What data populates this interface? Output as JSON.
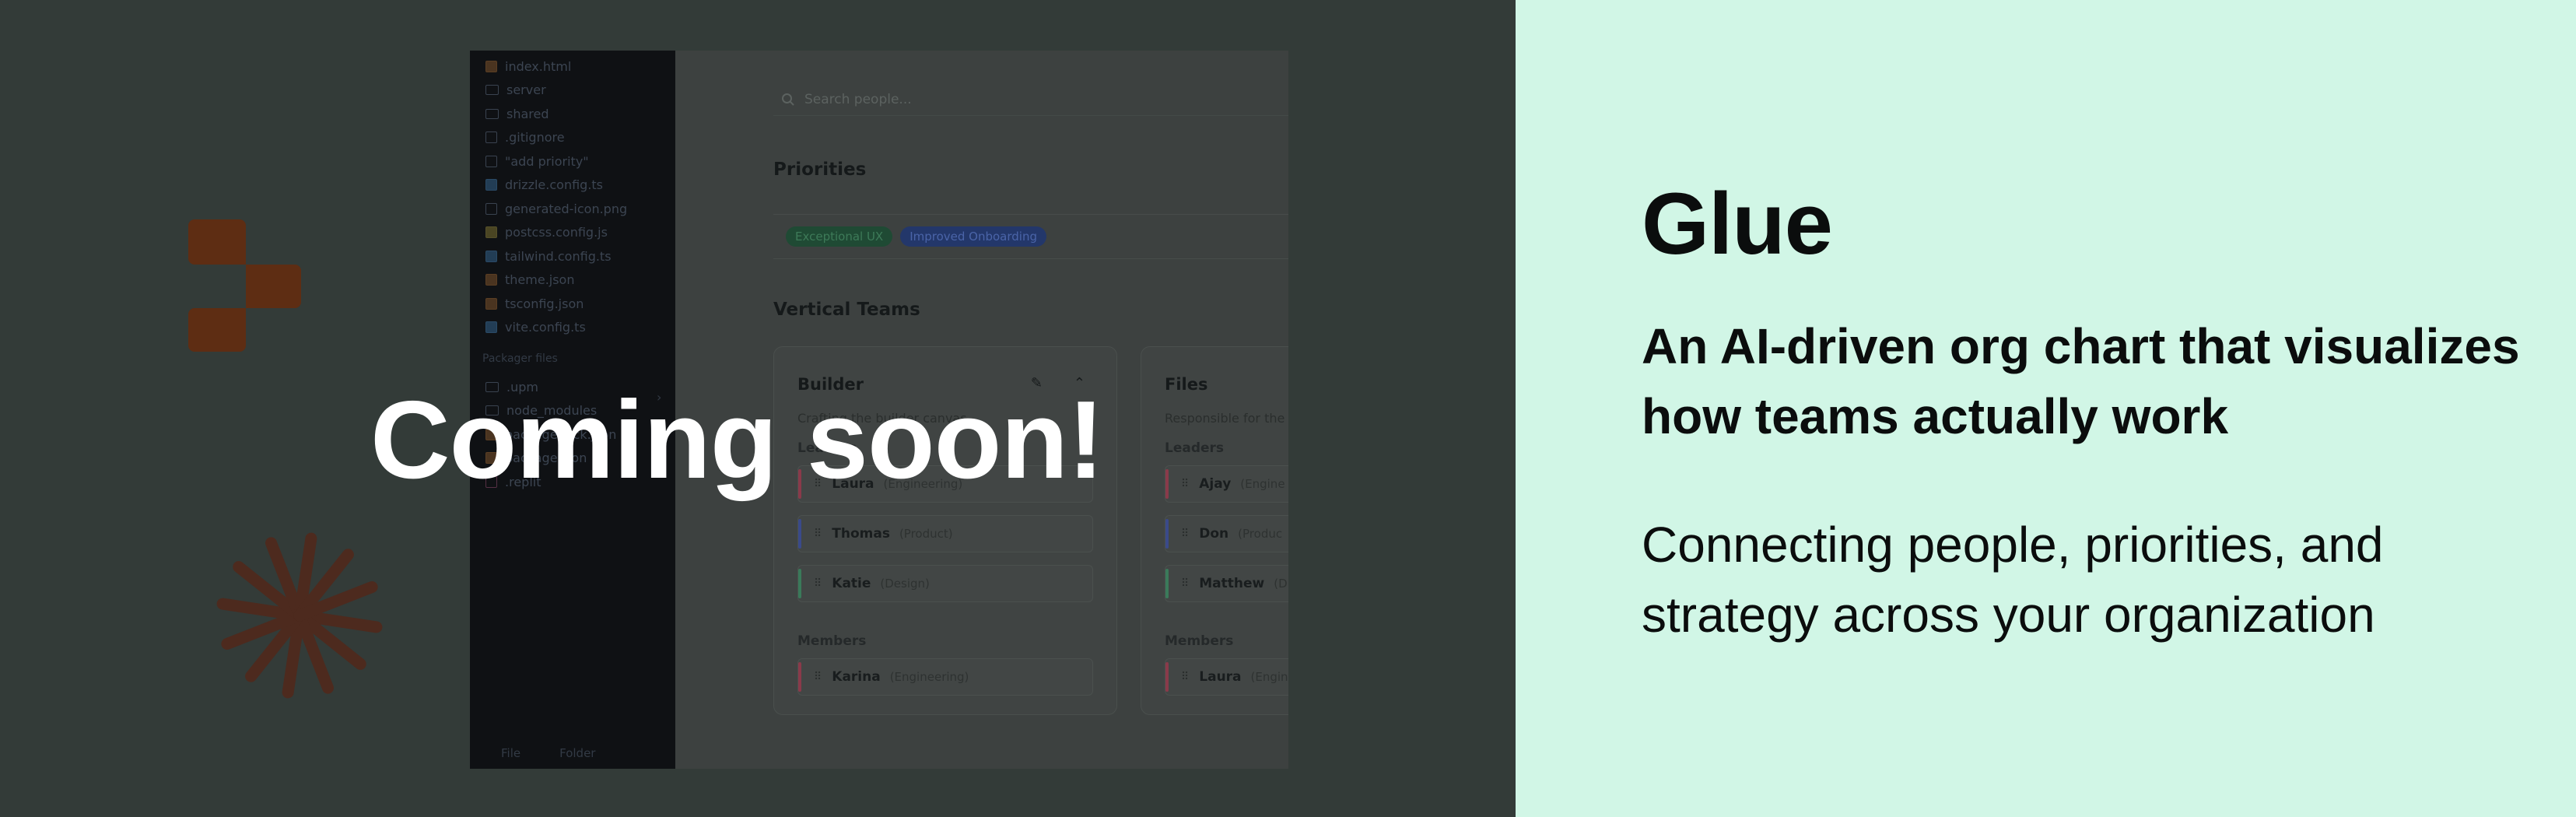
{
  "overlay": {
    "headline": "Coming soon!"
  },
  "product": {
    "name": "Glue",
    "tagline": "An AI-driven org chart that visualizes how teams actually work",
    "subtitle": "Connecting people, priorities, and strategy across your organization"
  },
  "sidebar": {
    "files": [
      {
        "label": "index.html",
        "icon": "html-file-icon"
      },
      {
        "label": "server",
        "icon": "folder-icon"
      },
      {
        "label": "shared",
        "icon": "folder-icon"
      },
      {
        "label": ".gitignore",
        "icon": "file-icon"
      },
      {
        "label": "\"add priority\"",
        "icon": "file-icon"
      },
      {
        "label": "drizzle.config.ts",
        "icon": "ts-file-icon"
      },
      {
        "label": "generated-icon.png",
        "icon": "image-file-icon"
      },
      {
        "label": "postcss.config.js",
        "icon": "js-file-icon"
      },
      {
        "label": "tailwind.config.ts",
        "icon": "ts-file-icon"
      },
      {
        "label": "theme.json",
        "icon": "json-file-icon"
      },
      {
        "label": "tsconfig.json",
        "icon": "json-file-icon"
      },
      {
        "label": "vite.config.ts",
        "icon": "ts-file-icon"
      }
    ],
    "packager_label": "Packager files",
    "packager_files": [
      {
        "label": ".upm",
        "icon": "folder-icon"
      },
      {
        "label": "node_modules",
        "icon": "folder-icon"
      },
      {
        "label": "package-lock.json",
        "icon": "json-file-icon"
      },
      {
        "label": "package.json",
        "icon": "json-file-icon"
      },
      {
        "label": ".replit",
        "icon": "replit-file-icon"
      }
    ],
    "footer_file": "File",
    "footer_folder": "Folder"
  },
  "main": {
    "search_placeholder": "Search people...",
    "priorities_title": "Priorities",
    "priorities": [
      {
        "label": "Exceptional UX",
        "color": "green"
      },
      {
        "label": "Improved Onboarding",
        "color": "blue"
      }
    ],
    "vertical_teams_title": "Vertical Teams",
    "teams": [
      {
        "name": "Builder",
        "description": "Crafting the builder canvas",
        "leaders_label": "Leaders",
        "leaders": [
          {
            "name": "Laura",
            "role": "(Engineering)",
            "accent": "#8a3a4a"
          },
          {
            "name": "Thomas",
            "role": "(Product)",
            "accent": "#3a4a8a"
          },
          {
            "name": "Katie",
            "role": "(Design)",
            "accent": "#3a7a5a"
          }
        ],
        "members_label": "Members",
        "members": [
          {
            "name": "Karina",
            "role": "(Engineering)",
            "accent": "#8a3a4a"
          }
        ]
      },
      {
        "name": "Files",
        "description": "Responsible for the",
        "leaders_label": "Leaders",
        "leaders": [
          {
            "name": "Ajay",
            "role": "(Engine",
            "accent": "#8a3a4a"
          },
          {
            "name": "Don",
            "role": "(Produc",
            "accent": "#3a4a8a"
          },
          {
            "name": "Matthew",
            "role": "(D",
            "accent": "#3a7a5a"
          }
        ],
        "members_label": "Members",
        "members": [
          {
            "name": "Laura",
            "role": "(Engin",
            "accent": "#8a3a4a"
          }
        ]
      }
    ]
  },
  "colors": {
    "left_background": "#333b38",
    "right_background": "#d1f6e6",
    "logo": "#5e2d13",
    "burst": "#4d2a1e"
  }
}
